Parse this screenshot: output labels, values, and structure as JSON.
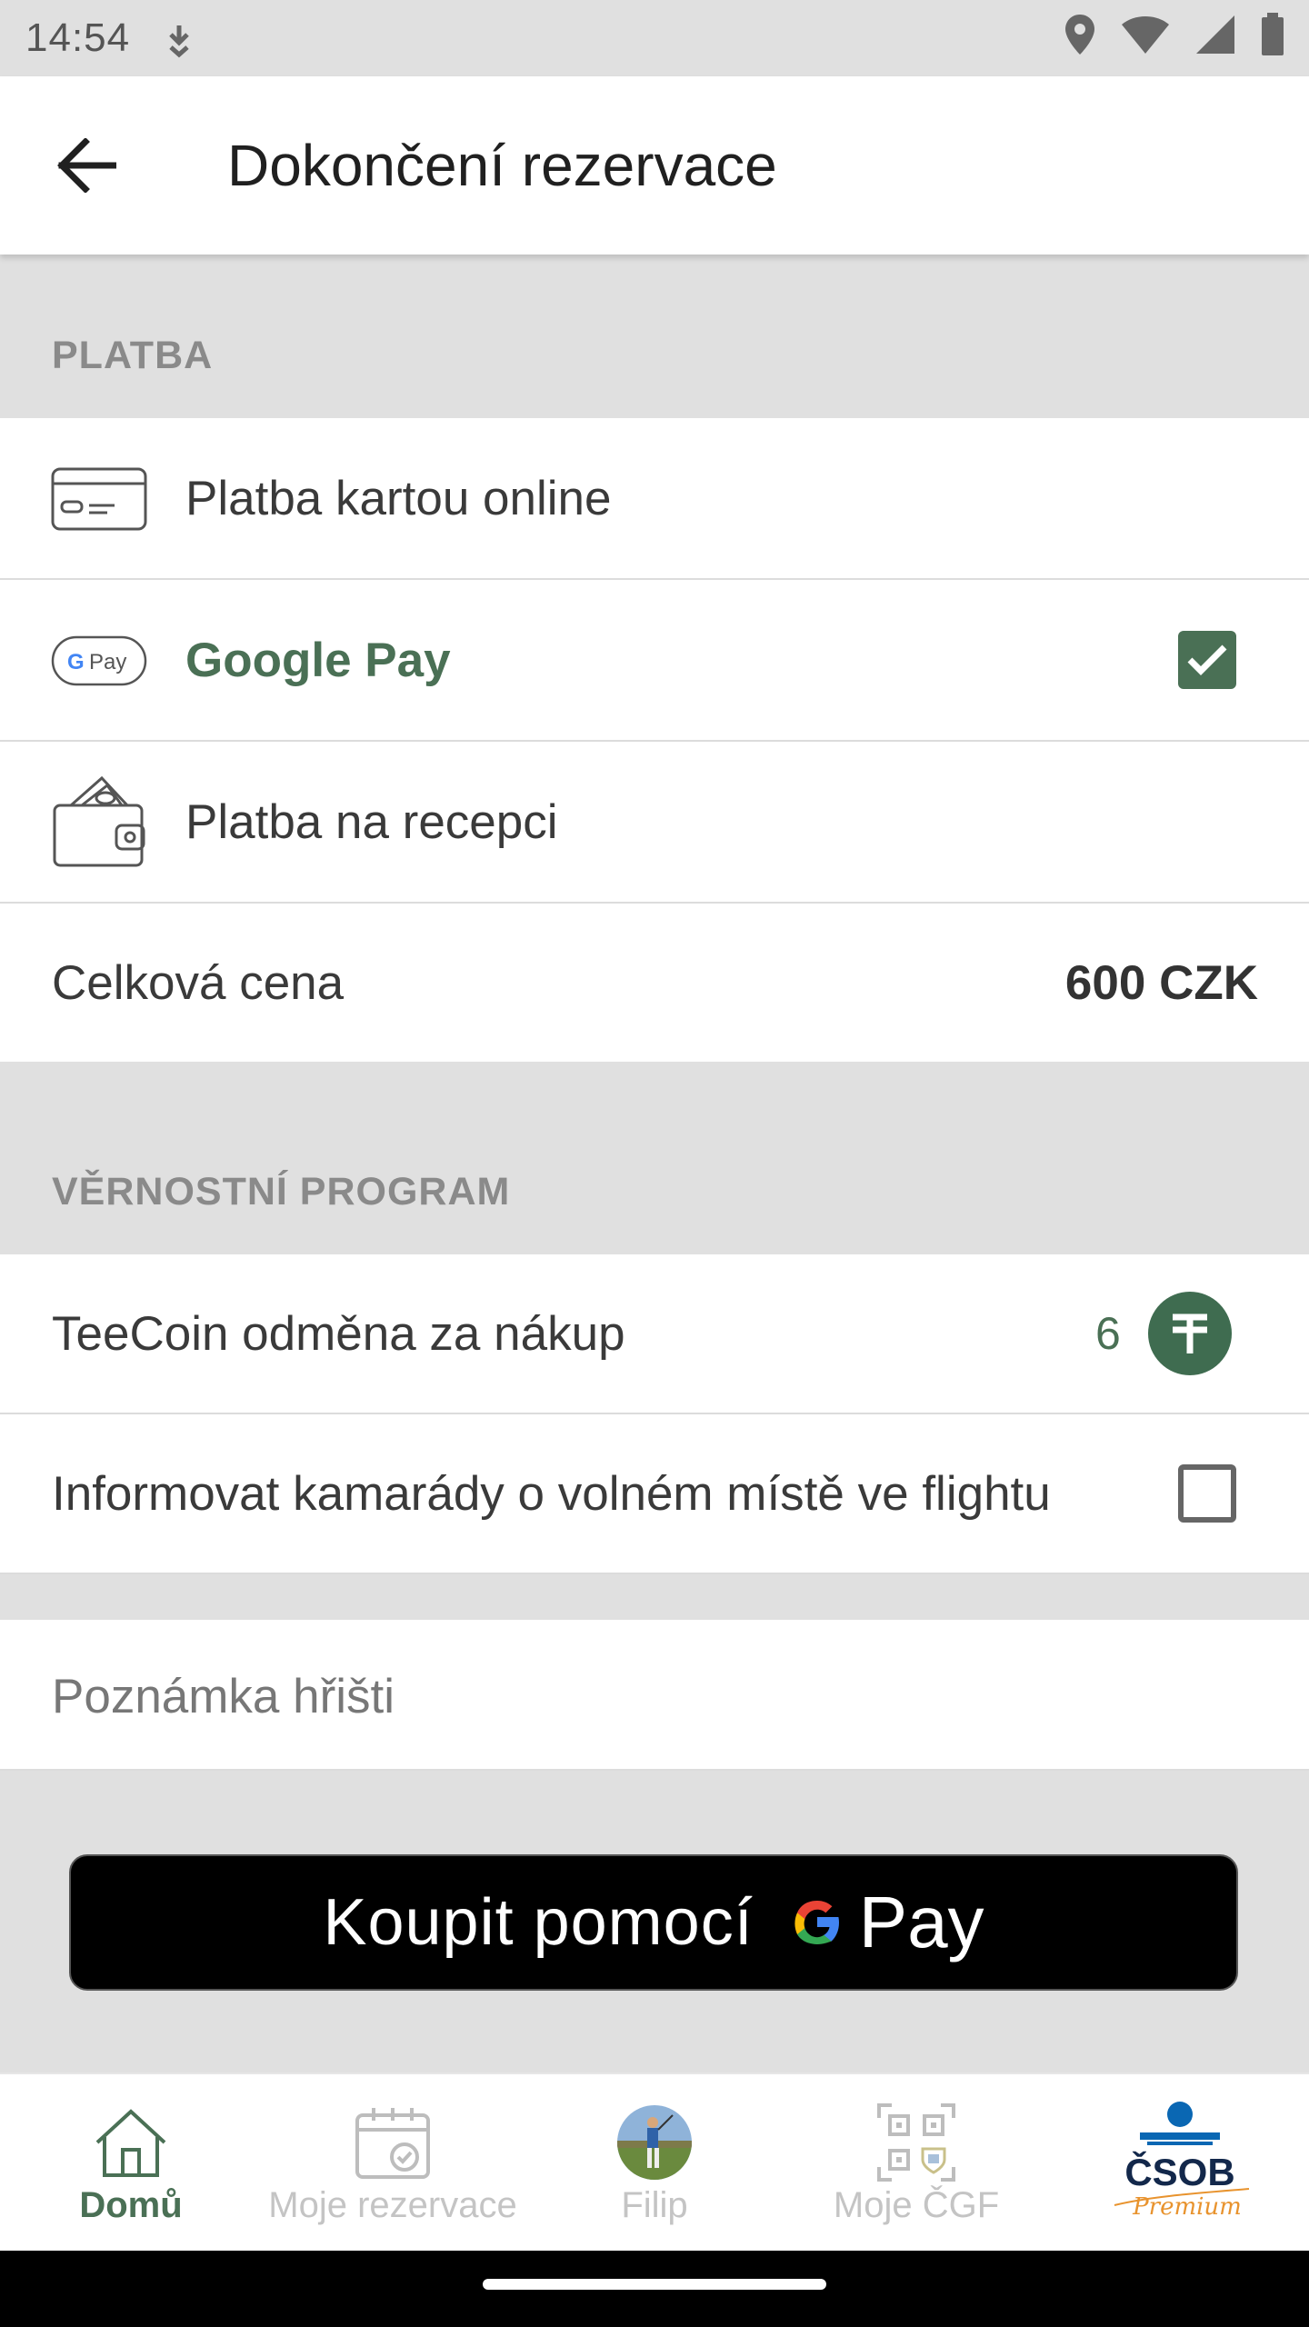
{
  "status_bar": {
    "time": "14:54"
  },
  "header": {
    "title": "Dokončení rezervace"
  },
  "payment": {
    "section_label": "PLATBA",
    "methods": [
      {
        "label": "Platba kartou online",
        "icon": "credit-card-icon",
        "selected": false
      },
      {
        "label": "Google Pay",
        "icon": "google-pay-icon",
        "selected": true
      },
      {
        "label": "Platba na recepci",
        "icon": "wallet-icon",
        "selected": false
      }
    ],
    "total_label": "Celková cena",
    "total_value": "600 CZK"
  },
  "loyalty": {
    "section_label": "VĚRNOSTNÍ PROGRAM",
    "teecoin_label": "TeeCoin odměna za nákup",
    "teecoin_value": "6",
    "notify_label": "Informovat kamarády o volném místě ve flightu",
    "notify_checked": false
  },
  "note": {
    "placeholder": "Poznámka hřišti",
    "value": ""
  },
  "buy_button": {
    "label": "Koupit pomocí",
    "pay_word": "Pay"
  },
  "bottom_nav": {
    "items": [
      {
        "label": "Domů",
        "icon": "home-icon",
        "active": true
      },
      {
        "label": "Moje rezervace",
        "icon": "calendar-check-icon",
        "active": false
      },
      {
        "label": "Filip",
        "icon": "profile-avatar",
        "active": false
      },
      {
        "label": "Moje ČGF",
        "icon": "qr-code-icon",
        "active": false
      },
      {
        "label": "ČSOB",
        "sublabel": "Premium",
        "icon": "csob-premium-logo",
        "active": false
      }
    ]
  },
  "colors": {
    "accent": "#4a7055",
    "background": "#e0e0e0",
    "section_text": "#8a8a8a",
    "inactive_nav": "#c4c4c4",
    "csob_blue": "#0a67b3",
    "csob_navy": "#13284b",
    "premium_orange": "#e8932e"
  }
}
